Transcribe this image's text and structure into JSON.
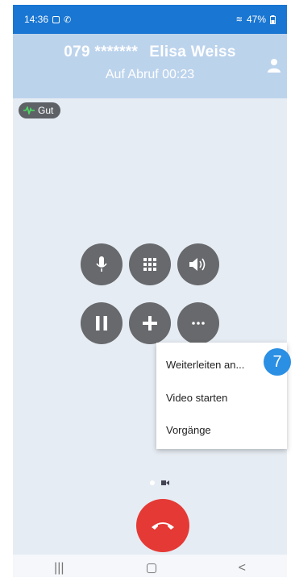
{
  "status_bar": {
    "time": "14:36",
    "battery": "47%"
  },
  "call": {
    "number": "079 *******",
    "name": "Elisa Weiss",
    "status": "Auf Abruf 00:23"
  },
  "quality": {
    "label": "Gut"
  },
  "controls": [
    {
      "name": "mute-button",
      "icon": "microphone-icon"
    },
    {
      "name": "keypad-button",
      "icon": "keypad-icon"
    },
    {
      "name": "speaker-button",
      "icon": "speaker-icon"
    },
    {
      "name": "hold-button",
      "icon": "pause-icon"
    },
    {
      "name": "add-call-button",
      "icon": "plus-icon"
    },
    {
      "name": "more-button",
      "icon": "more-icon"
    }
  ],
  "menu": {
    "items": [
      "Weiterleiten an...",
      "Video starten",
      "Vorgänge"
    ]
  },
  "callout": {
    "number": "7"
  },
  "colors": {
    "status_bar": "#1976d2",
    "header": "#bcd3ec",
    "control": "#67696c",
    "hangup": "#e53935",
    "badge": "#2b8fe4"
  }
}
